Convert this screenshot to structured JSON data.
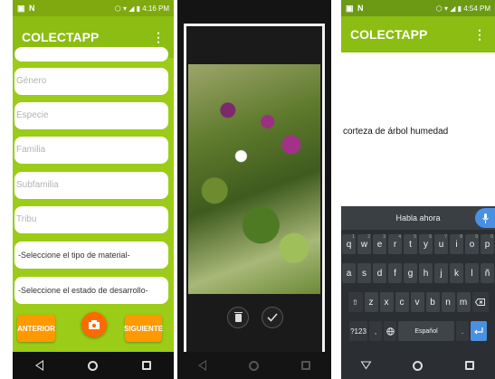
{
  "panel1": {
    "status": {
      "left": "▣ N",
      "right": "⬡ ▾ ◢ ▮ 4:16 PM"
    },
    "app_title": "COLECTAPP",
    "menu_label": "⋮",
    "fields": [
      "Género",
      "Especie",
      "Familia",
      "Subfamilia",
      "Tribu"
    ],
    "select_material": "-Seleccione el tipo de material-",
    "select_estado": "-Seleccione el estado de desarrollo-",
    "btn_prev": "ANTERIOR",
    "btn_next": "SIGUIENTE"
  },
  "panel3": {
    "status": {
      "left": "▣ N",
      "right": "⬡ ▾ ◢ ▮ 4:54 PM"
    },
    "app_title": "COLECTAPP",
    "menu_label": "⋮",
    "entered_text": "corteza de árbol humedad",
    "voice_prompt": "Habla ahora",
    "keyboard": {
      "row1": [
        [
          "q",
          "1"
        ],
        [
          "w",
          "2"
        ],
        [
          "e",
          "3"
        ],
        [
          "r",
          "4"
        ],
        [
          "t",
          "5"
        ],
        [
          "y",
          "6"
        ],
        [
          "u",
          "7"
        ],
        [
          "i",
          "8"
        ],
        [
          "o",
          "9"
        ],
        [
          "p",
          "0"
        ]
      ],
      "row2": [
        "a",
        "s",
        "d",
        "f",
        "g",
        "h",
        "j",
        "k",
        "l",
        "ñ"
      ],
      "row3": [
        "z",
        "x",
        "c",
        "v",
        "b",
        "n",
        "m"
      ],
      "symbols": "?123",
      "space": "Español",
      "comma": ",",
      "period": "."
    }
  },
  "colors": {
    "accent": "#9bcc17",
    "button": "#ff9900",
    "camera": "#ff6a00",
    "voice": "#4a90e2"
  }
}
